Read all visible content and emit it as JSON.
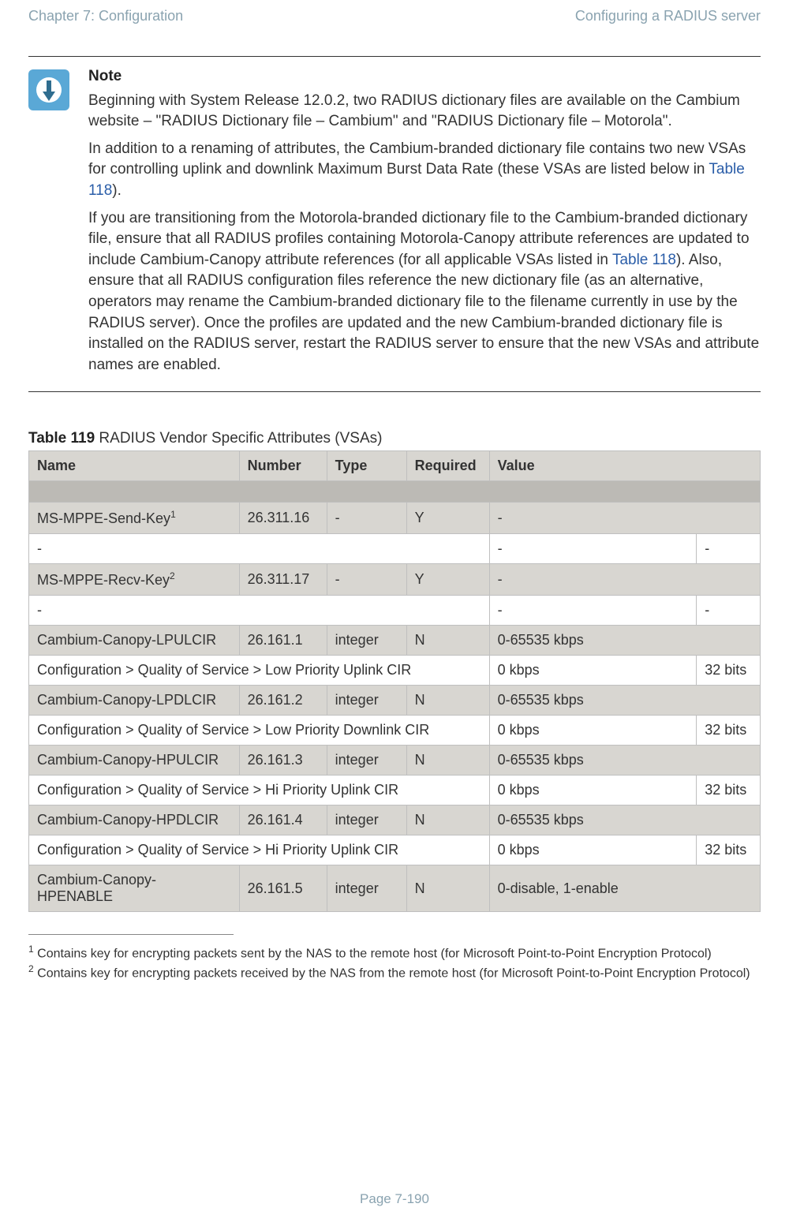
{
  "header": {
    "left": "Chapter 7:  Configuration",
    "right": "Configuring a RADIUS server"
  },
  "note": {
    "title": "Note",
    "para1_a": "Beginning with System Release 12.0.2, two RADIUS dictionary files are available on the Cambium website – \"RADIUS Dictionary file – Cambium\" and \"RADIUS Dictionary file – Motorola\".",
    "para2_a": "In addition to a renaming of attributes, the Cambium-branded dictionary file contains two new VSAs for controlling uplink and downlink Maximum Burst Data Rate (these VSAs are listed below in ",
    "para2_link": "Table 118",
    "para2_b": ").",
    "para3_a": "If you are transitioning from the Motorola-branded dictionary file to the Cambium-branded dictionary file, ensure that all RADIUS profiles containing Motorola-Canopy attribute references are updated to include Cambium-Canopy attribute references (for all applicable VSAs listed in ",
    "para3_link": "Table 118",
    "para3_b": ").  Also, ensure that all RADIUS configuration files reference the new dictionary file (as an alternative, operators may rename the Cambium-branded dictionary file to the filename currently in use by the RADIUS server). Once the profiles are updated and the new Cambium-branded dictionary file is installed on the RADIUS server, restart the RADIUS server to ensure that the new VSAs and attribute names are enabled."
  },
  "table_title_strong": "Table 119",
  "table_title_rest": " RADIUS Vendor Specific Attributes (VSAs)",
  "cols": {
    "name": "Name",
    "number": "Number",
    "type": "Type",
    "required": "Required",
    "value": "Value"
  },
  "rows": {
    "r1": {
      "name": "MS-MPPE-Send-Key",
      "sup": "1",
      "number": "26.311.16",
      "type": "-",
      "required": "Y",
      "value": "-"
    },
    "r2": {
      "name": "-",
      "value": "-",
      "extra": "-"
    },
    "r3": {
      "name": "MS-MPPE-Recv-Key",
      "sup": "2",
      "number": "26.311.17",
      "type": "-",
      "required": "Y",
      "value": "-"
    },
    "r4": {
      "name": "-",
      "value": "-",
      "extra": "-"
    },
    "r5": {
      "name": "Cambium-Canopy-LPULCIR",
      "number": "26.161.1",
      "type": "integer",
      "required": "N",
      "value": "0-65535 kbps"
    },
    "r6": {
      "name": "Configuration > Quality of Service > Low Priority Uplink CIR",
      "value": "0 kbps",
      "extra": "32 bits"
    },
    "r7": {
      "name": "Cambium-Canopy-LPDLCIR",
      "number": "26.161.2",
      "type": "integer",
      "required": "N",
      "value": "0-65535 kbps"
    },
    "r8": {
      "name": "Configuration > Quality of Service > Low Priority Downlink CIR",
      "value": "0 kbps",
      "extra": "32 bits"
    },
    "r9": {
      "name": "Cambium-Canopy-HPULCIR",
      "number": "26.161.3",
      "type": "integer",
      "required": "N",
      "value": "0-65535 kbps"
    },
    "r10": {
      "name": "Configuration > Quality of Service > Hi Priority Uplink CIR",
      "value": "0 kbps",
      "extra": "32 bits"
    },
    "r11": {
      "name": "Cambium-Canopy-HPDLCIR",
      "number": "26.161.4",
      "type": "integer",
      "required": "N",
      "value": "0-65535 kbps"
    },
    "r12": {
      "name": "Configuration > Quality of Service > Hi Priority Uplink CIR",
      "value": "0 kbps",
      "extra": "32 bits"
    },
    "r13": {
      "name": "Cambium-Canopy-HPENABLE",
      "number": "26.161.5",
      "type": "integer",
      "required": "N",
      "value": "0-disable, 1-enable"
    }
  },
  "footnotes": {
    "f1_sup": "1",
    "f1": " Contains key for encrypting packets sent by the NAS to the remote host (for Microsoft Point-to-Point Encryption Protocol)",
    "f2_sup": "2",
    "f2": " Contains key for encrypting packets received by the NAS from the remote host (for Microsoft Point-to-Point Encryption Protocol)"
  },
  "page_number": "Page 7-190"
}
